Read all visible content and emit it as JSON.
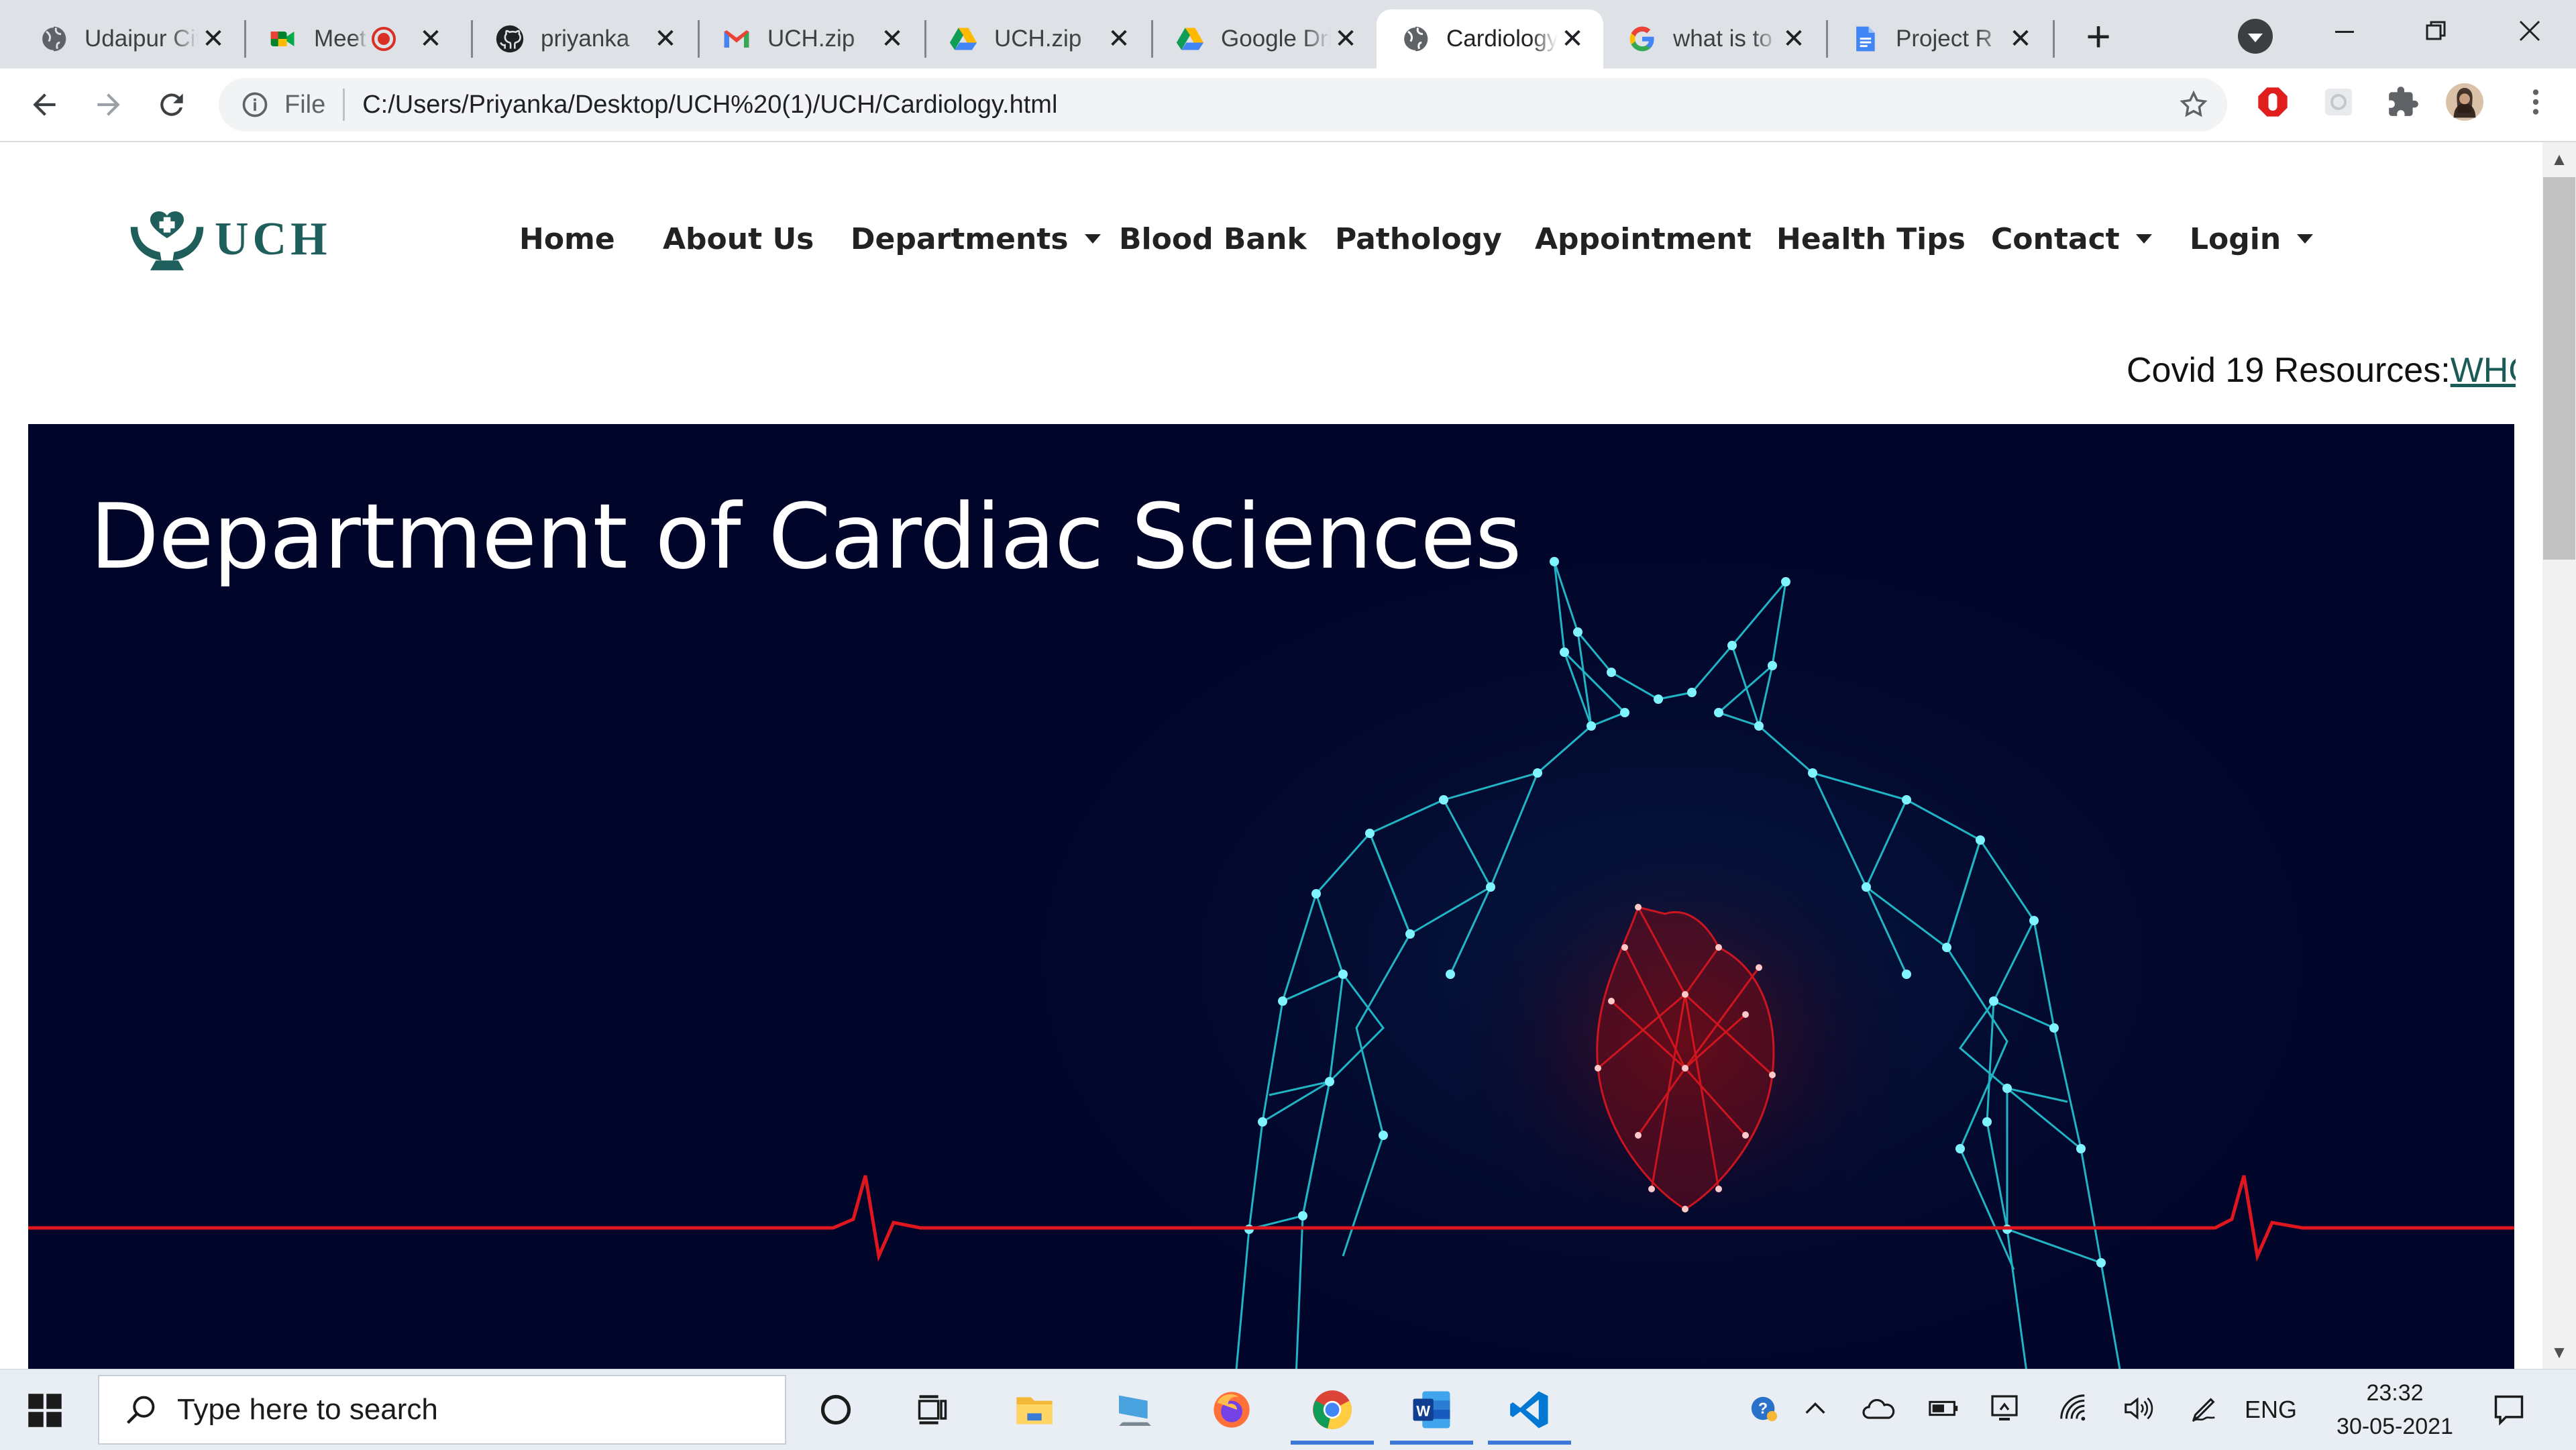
{
  "browser": {
    "tabs": [
      {
        "title": "Udaipur City Hospital",
        "icon": "globe-icon",
        "active": false
      },
      {
        "title": "Meet",
        "icon": "google-meet-icon",
        "active": false,
        "recording": true
      },
      {
        "title": "priyanka",
        "icon": "github-icon",
        "active": false
      },
      {
        "title": "UCH.zip",
        "icon": "gmail-icon",
        "active": false
      },
      {
        "title": "UCH.zip",
        "icon": "google-drive-icon",
        "active": false
      },
      {
        "title": "Google Drive",
        "icon": "google-drive-icon",
        "active": false
      },
      {
        "title": "Cardiology",
        "icon": "globe-icon",
        "active": true
      },
      {
        "title": "what is to",
        "icon": "google-icon",
        "active": false
      },
      {
        "title": "Project R",
        "icon": "google-docs-icon",
        "active": false
      }
    ],
    "close_glyph": "✕",
    "new_tab_glyph": "+",
    "address": {
      "scheme_label": "File",
      "url": "C:/Users/Priyanka/Desktop/UCH%20(1)/UCH/Cardiology.html"
    }
  },
  "site": {
    "logo_text": "UCH",
    "nav": [
      {
        "label": "Home",
        "dropdown": false
      },
      {
        "label": "About Us",
        "dropdown": false
      },
      {
        "label": "Departments",
        "dropdown": true
      },
      {
        "label": "Blood Bank",
        "dropdown": false
      },
      {
        "label": "Pathology",
        "dropdown": false
      },
      {
        "label": "Appointment",
        "dropdown": false
      },
      {
        "label": "Health Tips",
        "dropdown": false
      },
      {
        "label": "Contact",
        "dropdown": true
      },
      {
        "label": "Login",
        "dropdown": true
      }
    ],
    "covid": {
      "label": "Covid 19 Resources:",
      "link": "WHO"
    },
    "hero": {
      "title": "Department of Cardiac Sciences"
    },
    "colors": {
      "brand": "#1f5f5b",
      "hero_bg": "#02052a",
      "mesh": "#26d3df",
      "heart": "#e0161e"
    }
  },
  "taskbar": {
    "search_placeholder": "Type here to search",
    "language": "ENG",
    "time": "23:32",
    "date": "30-05-2021"
  }
}
